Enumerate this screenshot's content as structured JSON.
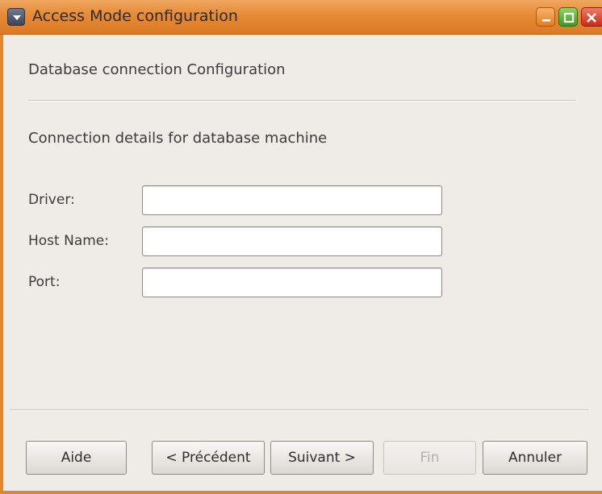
{
  "window": {
    "title": "Access Mode configuration"
  },
  "page": {
    "heading": "Database connection Configuration",
    "subheading": "Connection details for database machine"
  },
  "form": {
    "driver": {
      "label": "Driver:",
      "value": ""
    },
    "host_name": {
      "label": "Host Name:",
      "value": ""
    },
    "port": {
      "label": "Port:",
      "value": ""
    }
  },
  "buttons": {
    "help": "Aide",
    "previous": "< Précédent",
    "next": "Suivant >",
    "finish": "Fin",
    "cancel": "Annuler"
  },
  "icons": {
    "window_menu": "chevron-down-icon",
    "minimize": "minimize-icon",
    "maximize": "maximize-icon",
    "close": "close-icon"
  },
  "colors": {
    "titlebar": "#e58a36",
    "window_border": "#e0862e",
    "background": "#efebe7"
  }
}
